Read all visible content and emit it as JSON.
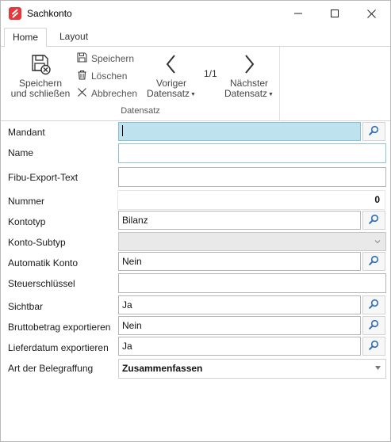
{
  "window": {
    "title": "Sachkonto"
  },
  "tabs": [
    {
      "label": "Home",
      "active": true
    },
    {
      "label": "Layout",
      "active": false
    }
  ],
  "ribbon": {
    "save_close": {
      "line1": "Speichern",
      "line2": "und schließen"
    },
    "save": "Speichern",
    "delete": "Löschen",
    "cancel": "Abbrechen",
    "prev": {
      "line1": "Voriger",
      "line2": "Datensatz"
    },
    "record_count": "1/1",
    "next": {
      "line1": "Nächster",
      "line2": "Datensatz"
    },
    "group_label": "Datensatz"
  },
  "form": {
    "mandant": {
      "label": "Mandant",
      "value": ""
    },
    "name": {
      "label": "Name",
      "value": ""
    },
    "fibu_export_text": {
      "label": "Fibu-Export-Text",
      "value": ""
    },
    "nummer": {
      "label": "Nummer",
      "value": "0"
    },
    "kontotyp": {
      "label": "Kontotyp",
      "value": "Bilanz"
    },
    "konto_subtyp": {
      "label": "Konto-Subtyp",
      "value": ""
    },
    "automatik_konto": {
      "label": "Automatik Konto",
      "value": "Nein"
    },
    "steuerschluessel": {
      "label": "Steuerschlüssel",
      "value": ""
    },
    "sichtbar": {
      "label": "Sichtbar",
      "value": "Ja"
    },
    "bruttobetrag_exportieren": {
      "label": "Bruttobetrag exportieren",
      "value": "Nein"
    },
    "lieferdatum_exportieren": {
      "label": "Lieferdatum exportieren",
      "value": "Ja"
    },
    "art_der_belegraffung": {
      "label": "Art der Belegraffung",
      "value": "Zusammenfassen"
    }
  },
  "colors": {
    "accent": "#2f6db5",
    "focus_field": "#bfe3ee",
    "app_icon": "#e5383b"
  },
  "icons": {
    "app": "app-logo-icon",
    "minimize": "minimize-icon",
    "maximize": "maximize-icon",
    "close": "close-icon",
    "save_close": "save-close-icon",
    "save": "floppy-disk-icon",
    "delete": "trash-icon",
    "cancel": "x-icon",
    "prev": "chevron-left-icon",
    "next": "chevron-right-icon",
    "lookup": "search-icon"
  }
}
